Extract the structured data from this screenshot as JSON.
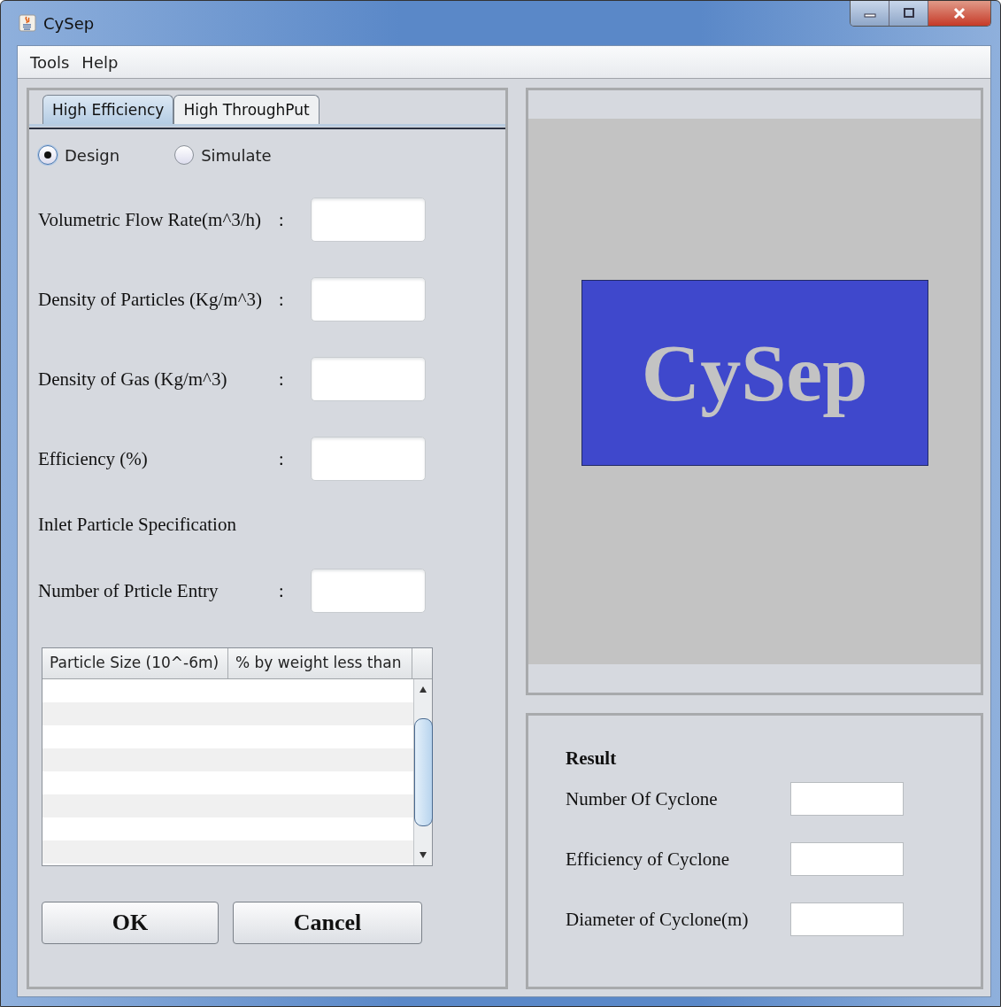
{
  "window": {
    "title": "CySep"
  },
  "menu": [
    "Tools",
    "Help"
  ],
  "tabs": [
    {
      "label": "High Efficiency",
      "selected": true
    },
    {
      "label": "High ThroughPut",
      "selected": false
    }
  ],
  "modes": [
    {
      "label": "Design",
      "selected": true
    },
    {
      "label": "Simulate",
      "selected": false
    }
  ],
  "fields": [
    {
      "kind": "field",
      "label": "Volumetric Flow Rate(m^3/h)",
      "colon": ":"
    },
    {
      "kind": "field",
      "label": "Density of Particles (Kg/m^3)",
      "colon": ":"
    },
    {
      "kind": "field",
      "label": "Density of Gas (Kg/m^3)",
      "colon": ":"
    },
    {
      "kind": "field",
      "label": "Efficiency  (%)",
      "colon": ":"
    },
    {
      "kind": "heading",
      "label": "Inlet Particle Specification"
    },
    {
      "kind": "field",
      "label": "Number of Prticle Entry",
      "colon": ":"
    }
  ],
  "table": {
    "columns": [
      "Particle Size (10^-6m)",
      "% by weight less than"
    ]
  },
  "buttons": [
    "OK",
    "Cancel"
  ],
  "logo": {
    "text": "CySep"
  },
  "result": {
    "title": "Result",
    "fields": [
      {
        "label": "Number Of Cyclone"
      },
      {
        "label": "Efficiency of Cyclone"
      },
      {
        "label": "Diameter of Cyclone(m)"
      }
    ]
  }
}
